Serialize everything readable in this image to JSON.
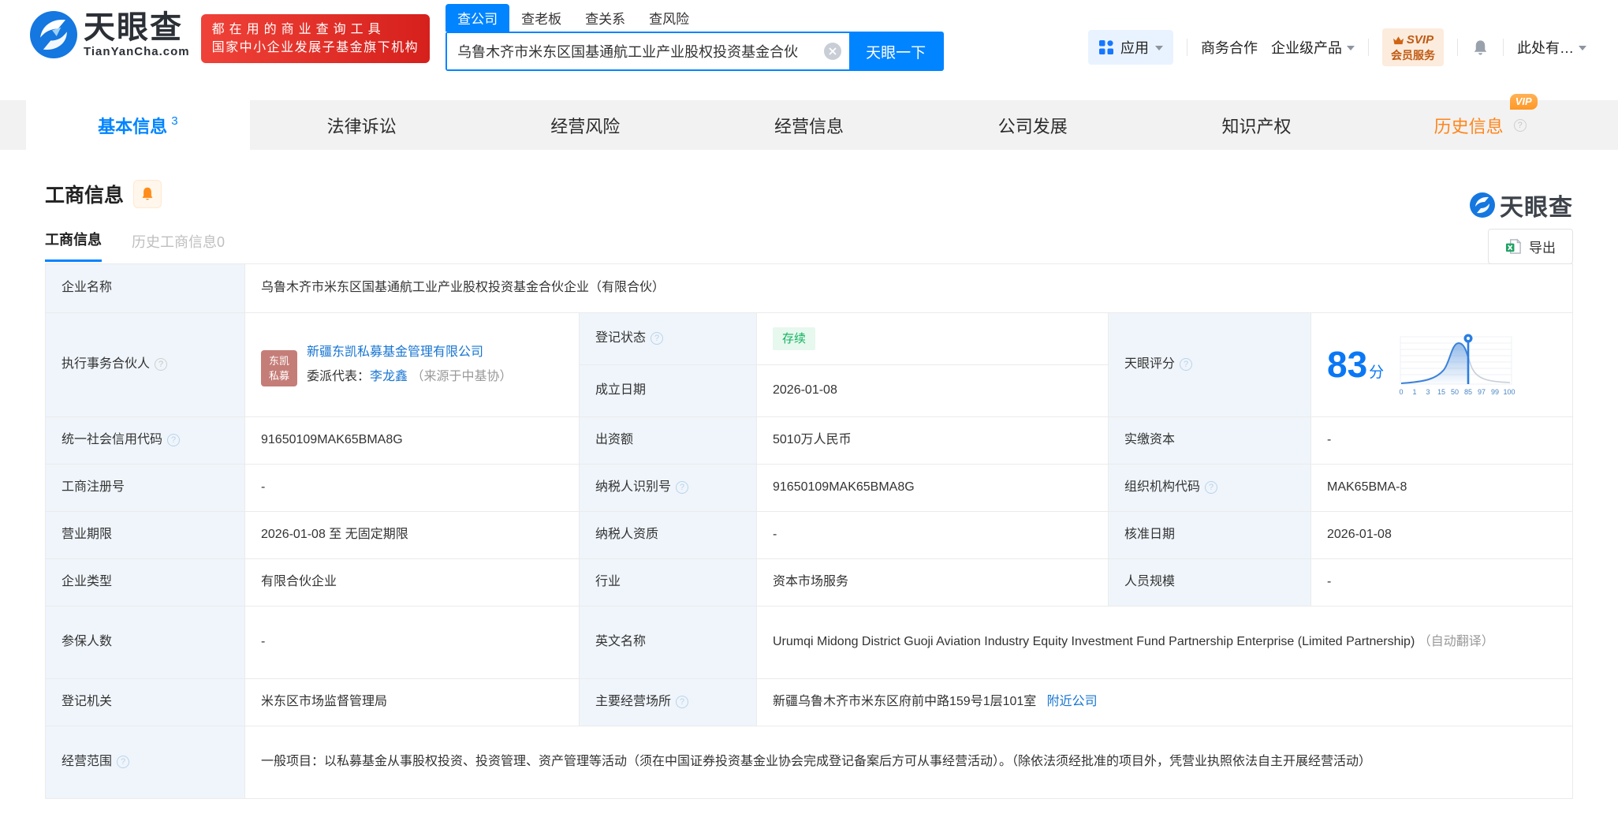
{
  "colors": {
    "primary": "#0084ff",
    "link": "#1775d2",
    "orange": "#ff8519",
    "green_badge_text": "#12b35f",
    "green_badge_bg": "#e7f8ee",
    "label_cell_bg": "#eff5fb",
    "promo_red": "#d6201c",
    "score_blue": "#0a78f5"
  },
  "header": {
    "logo": {
      "title": "天眼查",
      "subtitle": "TianYanCha.com"
    },
    "promo": {
      "line1": "都在用的商业查询工具",
      "line2": "国家中小企业发展子基金旗下机构"
    },
    "search": {
      "tabs": [
        {
          "label": "查公司",
          "active": true
        },
        {
          "label": "查老板",
          "active": false
        },
        {
          "label": "查关系",
          "active": false
        },
        {
          "label": "查风险",
          "active": false
        }
      ],
      "input_value": "乌鲁木齐市米东区国基通航工业产业股权投资基金合伙",
      "button_label": "天眼一下"
    },
    "nav": {
      "apps_label": "应用",
      "cooperation_label": "商务合作",
      "enterprise_label": "企业级产品",
      "svip_line1": "SVIP",
      "svip_line2": "会员服务",
      "more_label": "此处有…"
    }
  },
  "tabs": {
    "basic": {
      "label": "基本信息",
      "count": "3"
    },
    "legal": {
      "label": "法律诉讼"
    },
    "risk": {
      "label": "经营风险"
    },
    "operation": {
      "label": "经营信息"
    },
    "development": {
      "label": "公司发展"
    },
    "ip": {
      "label": "知识产权"
    },
    "history": {
      "label": "历史信息",
      "vip_label": "VIP"
    }
  },
  "section": {
    "title": "工商信息",
    "watermark": "天眼查",
    "subtab_current": "工商信息",
    "subtab_history": "历史工商信息0",
    "export_label": "导出"
  },
  "table": {
    "company_name_label": "企业名称",
    "company_name": "乌鲁木齐市米东区国基通航工业产业股权投资基金合伙企业（有限合伙）",
    "partner": {
      "label": "执行事务合伙人",
      "avatar_line1": "东凯",
      "avatar_line2": "私募",
      "company": "新疆东凯私募基金管理有限公司",
      "rep_label": "委派代表：",
      "rep_name": "李龙鑫",
      "rep_source": "（来源于中基协）"
    },
    "reg_status_label": "登记状态",
    "reg_status_value": "存续",
    "establish_label": "成立日期",
    "establish_value": "2026-01-08",
    "score_label": "天眼评分",
    "score_value": "83",
    "score_unit": "分",
    "rows": [
      {
        "l1": "统一社会信用代码",
        "v1": "91650109MAK65BMA8G",
        "l2": "出资额",
        "v2": "5010万人民币",
        "l3": "实缴资本",
        "v3": "-"
      },
      {
        "l1": "工商注册号",
        "v1": "-",
        "l2": "纳税人识别号",
        "v2": "91650109MAK65BMA8G",
        "l3": "组织机构代码",
        "v3": "MAK65BMA-8"
      },
      {
        "l1": "营业期限",
        "v1": "2026-01-08 至 无固定期限",
        "l2": "纳税人资质",
        "v2": "-",
        "l3": "核准日期",
        "v3": "2026-01-08"
      },
      {
        "l1": "企业类型",
        "v1": "有限合伙企业",
        "l2": "行业",
        "v2": "资本市场服务",
        "l3": "人员规模",
        "v3": "-"
      }
    ],
    "insured_label": "参保人数",
    "insured_value": "-",
    "english_label": "英文名称",
    "english_value": "Urumqi Midong District Guoji Aviation Industry Equity Investment Fund Partnership Enterprise (Limited Partnership)",
    "english_note": "（自动翻译）",
    "authority_label": "登记机关",
    "authority_value": "米东区市场监督管理局",
    "premises_label": "主要经营场所",
    "premises_value": "新疆乌鲁木齐市米东区府前中路159号1层101室",
    "nearby_link": "附近公司",
    "scope_label": "经营范围",
    "scope_value": "一般项目：以私募基金从事股权投资、投资管理、资产管理等活动（须在中国证券投资基金业协会完成登记备案后方可从事经营活动）。（除依法须经批准的项目外，凭营业执照依法自主开展经营活动）"
  },
  "chart_data": {
    "type": "area",
    "title": "天眼评分分布曲线",
    "score": 83,
    "marker_at": 85,
    "x_ticks": [
      "0",
      "1",
      "3",
      "15",
      "50",
      "85",
      "97",
      "99",
      "100"
    ],
    "shape": "bell curve, blue filled left of marker at 85, gray tail right of marker",
    "grid": true
  }
}
